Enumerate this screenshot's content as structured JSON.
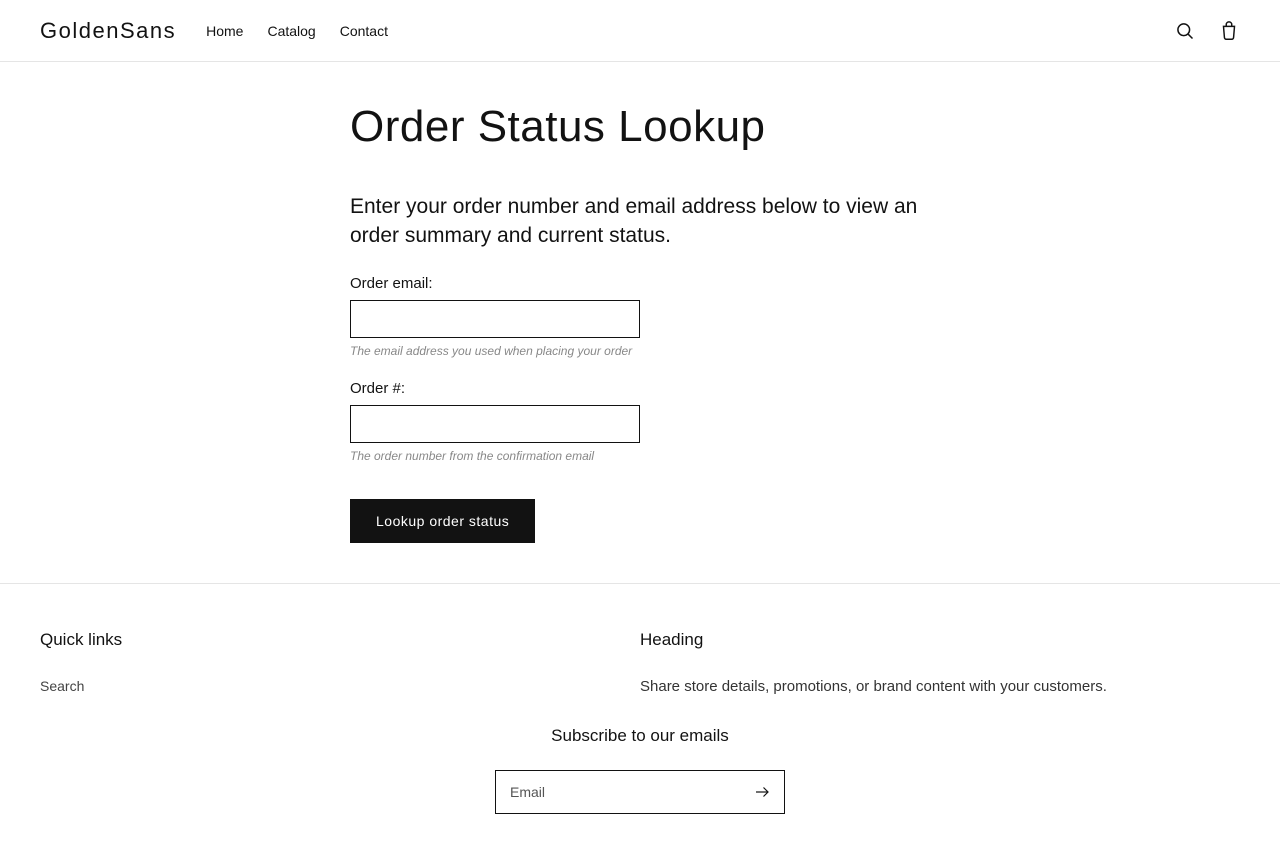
{
  "header": {
    "brand": "GoldenSans",
    "nav": [
      "Home",
      "Catalog",
      "Contact"
    ]
  },
  "main": {
    "title": "Order Status Lookup",
    "subtitle": "Enter your order number and email address below to view an order summary and current status.",
    "form": {
      "email_label": "Order email:",
      "email_hint": "The email address you used when placing your order",
      "order_label": "Order #:",
      "order_hint": "The order number from the confirmation email",
      "submit_label": "Lookup order status"
    }
  },
  "footer": {
    "col1": {
      "heading": "Quick links",
      "link": "Search"
    },
    "col2": {
      "heading": "Heading",
      "text": "Share store details, promotions, or brand content with your customers."
    },
    "subscribe": {
      "title": "Subscribe to our emails",
      "placeholder": "Email"
    }
  }
}
